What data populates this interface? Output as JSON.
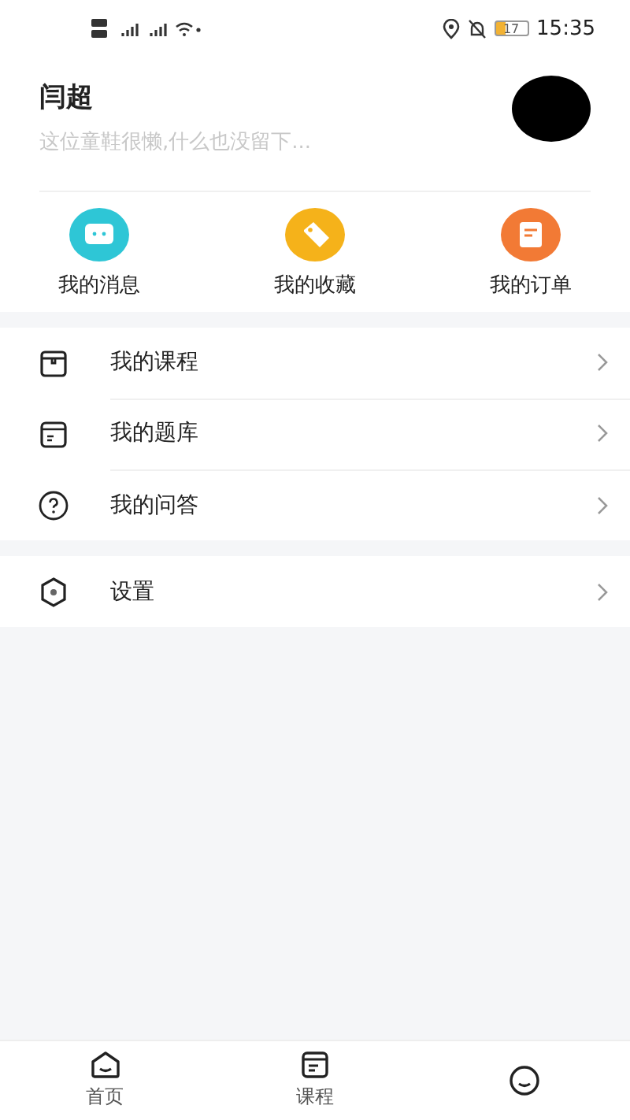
{
  "status_bar": {
    "time": "15:35",
    "battery": "17"
  },
  "profile": {
    "name": "闫超",
    "bio": "这位童鞋很懒,什么也没留下..."
  },
  "shortcuts": [
    {
      "label": "我的消息",
      "kind": "message",
      "color": "#2ec6d6"
    },
    {
      "label": "我的收藏",
      "kind": "tag",
      "color": "#f5b21a"
    },
    {
      "label": "我的订单",
      "kind": "order",
      "color": "#f27a35"
    }
  ],
  "menu": [
    {
      "label": "我的课程",
      "kind": "course"
    },
    {
      "label": "我的题库",
      "kind": "bank"
    },
    {
      "label": "我的问答",
      "kind": "qa"
    }
  ],
  "settings": {
    "label": "设置"
  },
  "tabs": [
    {
      "label": "首页",
      "kind": "home"
    },
    {
      "label": "课程",
      "kind": "course"
    },
    {
      "kind": "me"
    }
  ]
}
